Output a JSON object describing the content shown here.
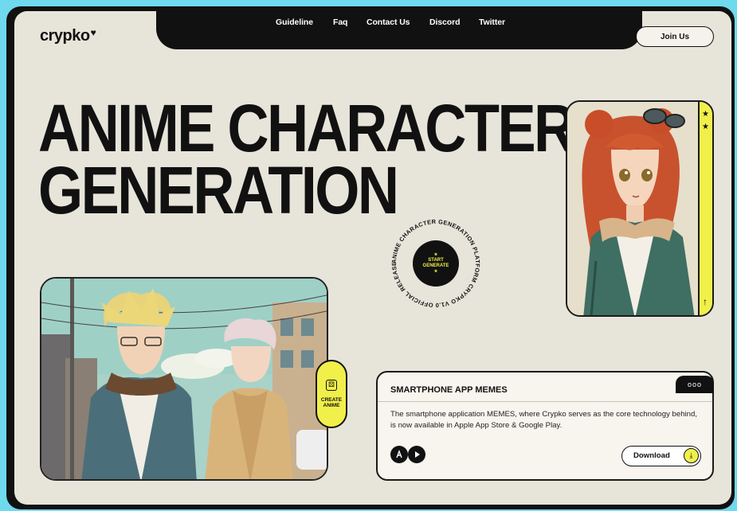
{
  "brand": {
    "name": "crypko",
    "mark": "♥"
  },
  "nav": {
    "items": [
      "Guideline",
      "Faq",
      "Contact Us",
      "Discord",
      "Twitter"
    ]
  },
  "header": {
    "join_label": "Join Us"
  },
  "hero": {
    "line1": "ANIME CHARACTER",
    "line2": "GENERATION"
  },
  "badge": {
    "ring_text": "ANIME CHARACTER GENERATION PLATFORM CRYPKO V1.0 OFFICIAL RELEASE •",
    "center_line1": "START",
    "center_line2": "GENERATE"
  },
  "portrait": {
    "stars": [
      "★",
      "★"
    ],
    "arrow": "↑"
  },
  "create": {
    "label_line1": "CREATE",
    "label_line2": "ANIME"
  },
  "app_card": {
    "tab_dots": "ooo",
    "title": "SMARTPHONE APP MEMES",
    "description": "The smartphone application MEMES, where Crypko serves as the core technology behind, is now available in Apple App Store & Google Play.",
    "download_label": "Download"
  },
  "colors": {
    "accent_yellow": "#f1ef4a",
    "ink": "#111111",
    "paper": "#e7e4da",
    "outer": "#6fd9ee"
  }
}
